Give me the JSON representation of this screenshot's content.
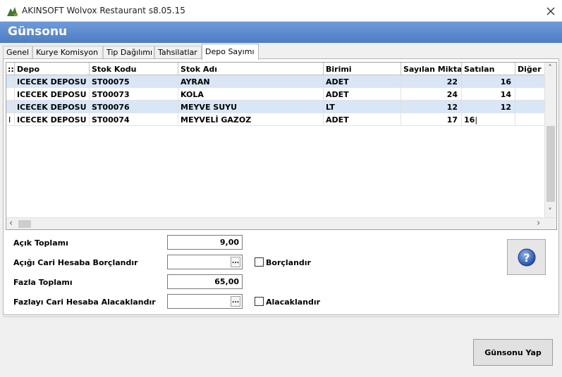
{
  "window": {
    "title": "AKINSOFT Wolvox Restaurant s8.05.15",
    "close_symbol": "✕"
  },
  "header": {
    "title": "Günsonu"
  },
  "tabs": [
    {
      "label": "Genel"
    },
    {
      "label": "Kurye Komisyon"
    },
    {
      "label": "Tip Dağılımı"
    },
    {
      "label": "Tahsilatlar"
    },
    {
      "label": "Depo Sayımı"
    }
  ],
  "grid": {
    "columns": [
      "Depo",
      "Stok Kodu",
      "Stok Adı",
      "Birimi",
      "Sayılan Miktar",
      "Satılan",
      "Diğer Ç"
    ],
    "rows": [
      {
        "depo": "ICECEK DEPOSU",
        "stok_kodu": "ST00075",
        "stok_adi": "AYRAN",
        "birimi": "ADET",
        "sayilan": "22",
        "satilan": "16"
      },
      {
        "depo": "ICECEK DEPOSU",
        "stok_kodu": "ST00073",
        "stok_adi": "KOLA",
        "birimi": "ADET",
        "sayilan": "24",
        "satilan": "14"
      },
      {
        "depo": "ICECEK DEPOSU",
        "stok_kodu": "ST00076",
        "stok_adi": "MEYVE SUYU",
        "birimi": "LT",
        "sayilan": "12",
        "satilan": "12"
      },
      {
        "depo": "ICECEK DEPOSU",
        "stok_kodu": "ST00074",
        "stok_adi": "MEYVELİ GAZOZ",
        "birimi": "ADET",
        "sayilan": "17",
        "satilan": "16"
      }
    ]
  },
  "summary": {
    "acik_toplami_label": "Açık Toplamı",
    "acik_toplami_value": "9,00",
    "acigi_cari_label": "Açığı Cari Hesaba Borçlandır",
    "borclandir_label": "Borçlandır",
    "fazla_toplami_label": "Fazla Toplamı",
    "fazla_toplami_value": "65,00",
    "fazlayi_cari_label": "Fazlayı Cari Hesaba Alacaklandır",
    "alacaklandir_label": "Alacaklandır",
    "ellipsis": "..."
  },
  "buttons": {
    "gunsonu_yap": "Günsonu Yap"
  },
  "colors": {
    "header_band": "#5b88cc",
    "selected_row": "#d8e6f7"
  }
}
